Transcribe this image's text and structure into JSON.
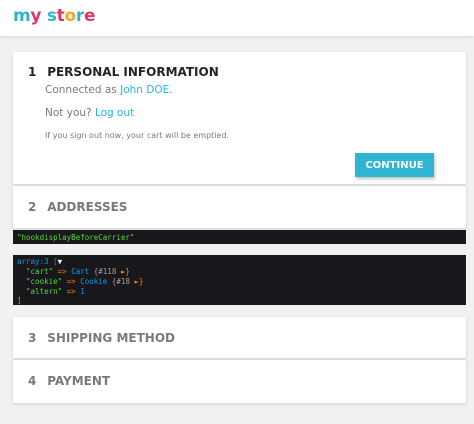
{
  "header": {
    "logo": {
      "letters": [
        "m",
        "y",
        " ",
        "s",
        "t",
        "o",
        "r",
        "e"
      ],
      "colors": [
        "#2fb5d2",
        "#e6335f",
        "#ffffff",
        "#2fb5d2",
        "#e6335f",
        "#f5a623",
        "#2fb5d2",
        "#e6335f"
      ]
    }
  },
  "steps": {
    "personal": {
      "number": "1",
      "title": "PERSONAL INFORMATION",
      "connected_prefix": "Connected as ",
      "connected_name": "John DOE",
      "connected_suffix": ".",
      "not_you": "Not you?",
      "logout": "Log out",
      "warning": "If you sign out now, your cart will be emptied.",
      "continue_label": "CONTINUE"
    },
    "addresses": {
      "number": "2",
      "title": "ADDRESSES"
    },
    "shipping": {
      "number": "3",
      "title": "SHIPPING METHOD"
    },
    "payment": {
      "number": "4",
      "title": "PAYMENT"
    }
  },
  "debug": {
    "hook": "\"hookdisplayBeforeCarrier\"",
    "array_label": "array:3 [",
    "array_toggle": "▼",
    "rows": [
      {
        "key": "\"cart\"",
        "arrow": " => ",
        "type": "Cart",
        "ref": " {#118 ",
        "expand": "►",
        "close": "}"
      },
      {
        "key": "\"cookie\"",
        "arrow": " => ",
        "type": "Cookie",
        "ref": " {#18 ",
        "expand": "►",
        "close": "}"
      },
      {
        "key": "\"altern\"",
        "arrow": " => ",
        "value": "1"
      }
    ],
    "array_close": "]"
  }
}
